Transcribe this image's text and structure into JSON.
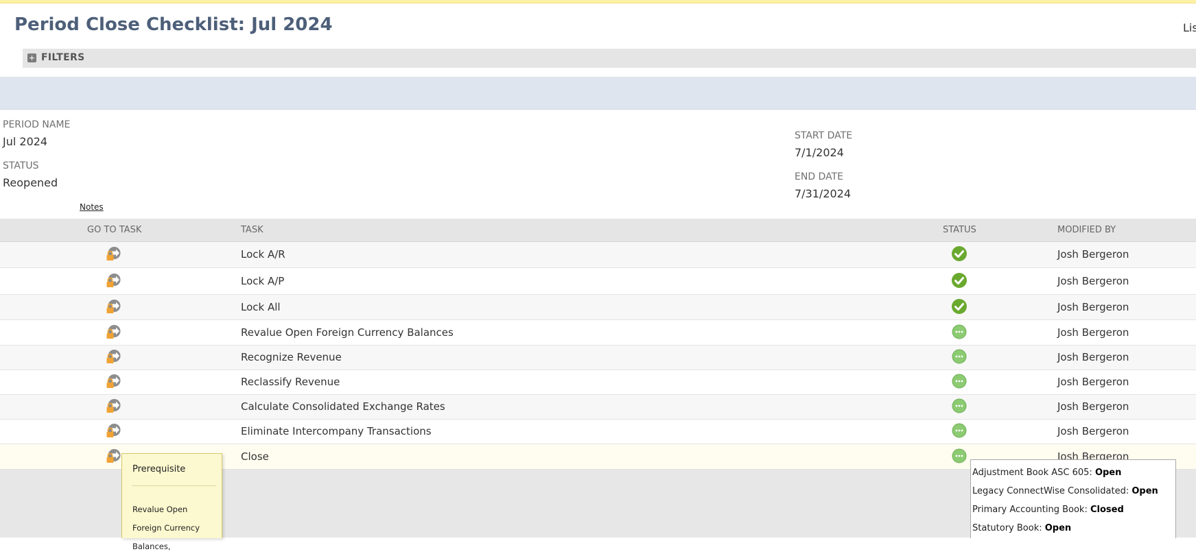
{
  "page": {
    "title": "Period Close Checklist: Jul 2024",
    "right_link": "Lis",
    "filters_label": "FILTERS"
  },
  "period": {
    "period_name_label": "PERIOD NAME",
    "period_name": "Jul 2024",
    "status_label": "STATUS",
    "status": "Reopened",
    "start_date_label": "START DATE",
    "start_date": "7/1/2024",
    "end_date_label": "END DATE",
    "end_date": "7/31/2024",
    "notes_link": "Notes"
  },
  "table": {
    "headers": {
      "go_to_task": "GO TO TASK",
      "task": "TASK",
      "status": "STATUS",
      "modified_by": "MODIFIED BY"
    },
    "rows": [
      {
        "task": "Lock A/R",
        "status_icon": "check-complete-icon",
        "modified_by": "Josh Bergeron"
      },
      {
        "task": "Lock A/P",
        "status_icon": "check-complete-icon",
        "modified_by": "Josh Bergeron"
      },
      {
        "task": "Lock All",
        "status_icon": "check-complete-icon",
        "modified_by": "Josh Bergeron"
      },
      {
        "task": "Revalue Open Foreign Currency Balances",
        "status_icon": "pending-dots-icon",
        "modified_by": "Josh Bergeron"
      },
      {
        "task": "Recognize Revenue",
        "status_icon": "pending-dots-icon",
        "modified_by": "Josh Bergeron"
      },
      {
        "task": "Reclassify Revenue",
        "status_icon": "pending-dots-icon",
        "modified_by": "Josh Bergeron"
      },
      {
        "task": "Calculate Consolidated Exchange Rates",
        "status_icon": "pending-dots-icon",
        "modified_by": "Josh Bergeron"
      },
      {
        "task": "Eliminate Intercompany Transactions",
        "status_icon": "pending-dots-icon",
        "modified_by": "Josh Bergeron"
      },
      {
        "task": "Close",
        "status_icon": "pending-dots-icon",
        "modified_by": "Josh Bergeron"
      }
    ]
  },
  "tooltip_prerequisite": {
    "title": "Prerequisite",
    "body": "Revalue Open Foreign Currency Balances,"
  },
  "tooltip_books": {
    "lines": [
      {
        "label": "Adjustment Book ASC 605:",
        "value": "Open"
      },
      {
        "label": "Legacy ConnectWise Consolidated:",
        "value": "Open"
      },
      {
        "label": "Primary Accounting Book:",
        "value": "Closed"
      },
      {
        "label": "Statutory Book:",
        "value": "Open"
      }
    ]
  },
  "colors": {
    "title": "#4d5f79",
    "band": "#dfe5ef",
    "status_complete": "#6aa92f",
    "status_pending": "#8ccb72",
    "lock": "#f0a334",
    "tooltip_bg": "#fcf8cf"
  }
}
